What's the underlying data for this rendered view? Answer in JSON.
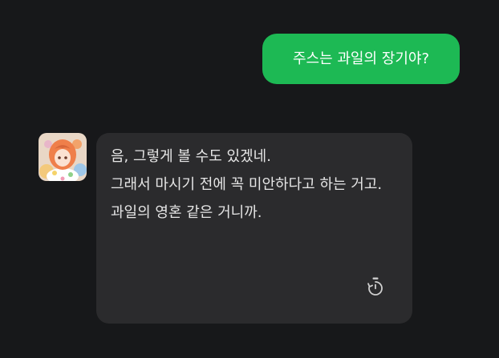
{
  "conversation": {
    "user_message": "주스는 과일의 장기야?",
    "bot_paragraphs": [
      "음, 그렇게 볼 수도 있겠네.",
      "그래서 마시기 전에 꼭 미안하다고 하는 거고.",
      "과일의 영혼 같은 거니까."
    ]
  },
  "icons": {
    "avatar": "character-avatar",
    "message_action": "timer-icon"
  },
  "colors": {
    "background": "#17181a",
    "user_bubble": "#1db954",
    "bot_bubble": "#2b2b2d",
    "bot_text": "#e6e6e6"
  }
}
